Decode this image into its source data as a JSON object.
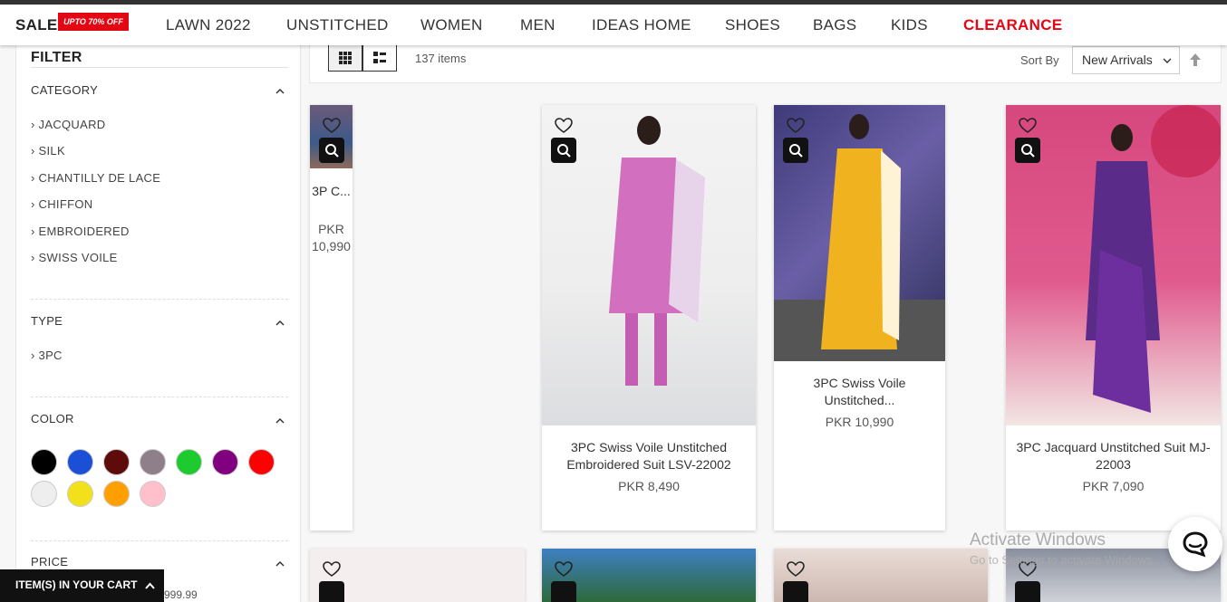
{
  "nav": {
    "sale": "SALE",
    "sale_badge": "UPTO 70% OFF",
    "items": [
      "LAWN 2022",
      "UNSTITCHED",
      "WOMEN",
      "MEN",
      "IDEAS HOME",
      "SHOES",
      "BAGS",
      "KIDS",
      "CLEARANCE"
    ]
  },
  "filter": {
    "title": "FILTER",
    "category": {
      "label": "CATEGORY",
      "items": [
        "JACQUARD",
        "SILK",
        "CHANTILLY DE LACE",
        "CHIFFON",
        "EMBROIDERED",
        "SWISS VOILE"
      ]
    },
    "type": {
      "label": "TYPE",
      "items": [
        "3PC"
      ]
    },
    "color": {
      "label": "COLOR",
      "swatches": [
        "#000000",
        "#1a4fd6",
        "#5e0b0b",
        "#8e7f8a",
        "#1ecb2e",
        "#800080",
        "#ff0000",
        "#eeeeee",
        "#f2e01a",
        "#ffa000",
        "#ffc0cb"
      ]
    },
    "price": {
      "label": "PRICE",
      "tail": "999.99"
    }
  },
  "toolbar": {
    "count": "137 items",
    "sort_by": "Sort By",
    "sort_value": "New Arrivals"
  },
  "products": [
    {
      "name": "3P C...",
      "price": "PKR 10,990"
    },
    {
      "name": "3PC Swiss Voile Unstitched Embroidered Suit LSV-22002",
      "price": "PKR 8,490"
    },
    {
      "name": "3PC Swiss Voile Unstitched...",
      "price": "PKR 10,990"
    },
    {
      "name": "3PC Jacquard Unstitched Suit MJ-22003",
      "price": "PKR 7,090"
    }
  ],
  "cart": {
    "label": "ITEM(S) IN YOUR CART"
  },
  "watermark": {
    "line1": "Activate Windows",
    "line2": "Go to Settings to activate Windows."
  }
}
